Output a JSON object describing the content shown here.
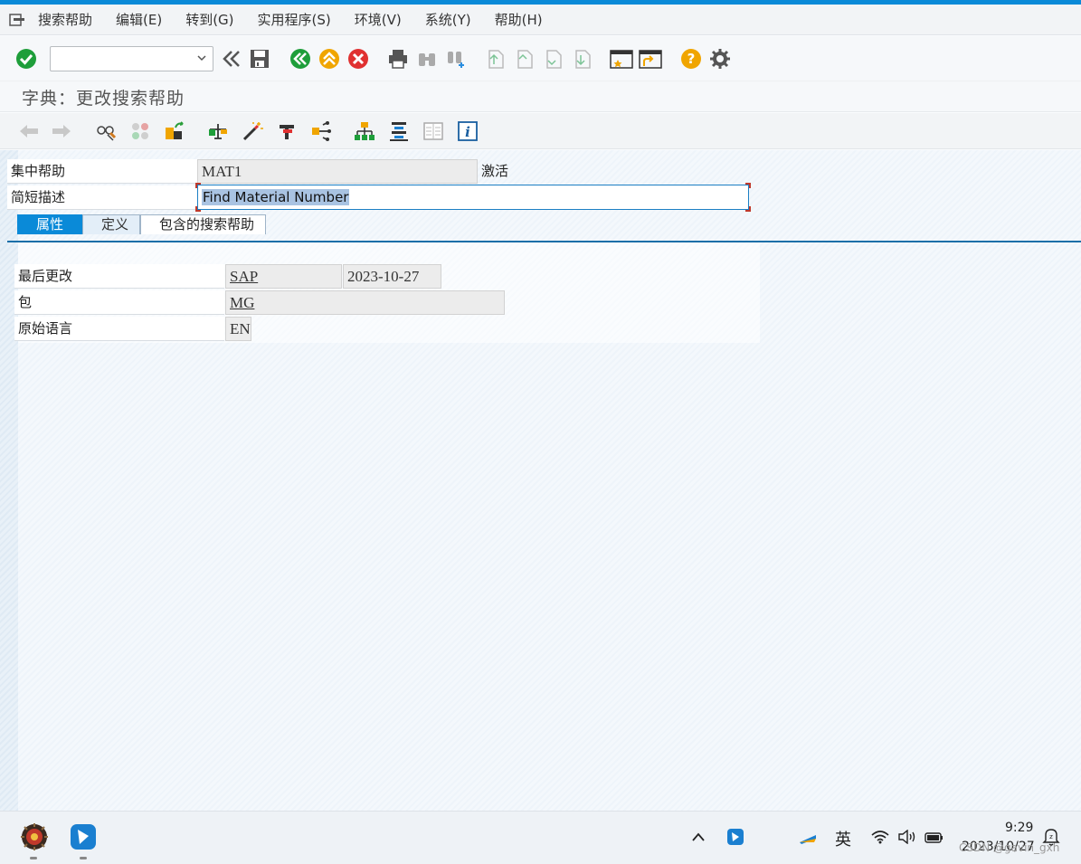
{
  "menubar": {
    "items": [
      "搜索帮助",
      "编辑(E)",
      "转到(G)",
      "实用程序(S)",
      "环境(V)",
      "系统(Y)",
      "帮助(H)"
    ]
  },
  "toolbar": {
    "command_value": "",
    "colors": {
      "green": "#1e9e3a",
      "orange": "#f0a500",
      "red": "#e03131",
      "blue": "#1a7fd0"
    }
  },
  "title": "字典：更改搜索帮助",
  "form": {
    "collective_help_label": "集中帮助",
    "collective_help_value": "MAT1",
    "status": "激活",
    "short_desc_label": "简短描述",
    "short_desc_value": "Find Material Number"
  },
  "tabs": [
    "属性",
    "定义",
    "包含的搜索帮助"
  ],
  "attributes": {
    "last_changed_label": "最后更改",
    "last_changed_by": "SAP",
    "last_changed_date": "2023-10-27",
    "package_label": "包",
    "package_value": "MG",
    "orig_lang_label": "原始语言",
    "orig_lang_value": "EN"
  },
  "taskbar": {
    "ime": "英",
    "time": "9:29",
    "date": "2023/10/27",
    "watermark": "CSDN @gavin_gxh"
  }
}
